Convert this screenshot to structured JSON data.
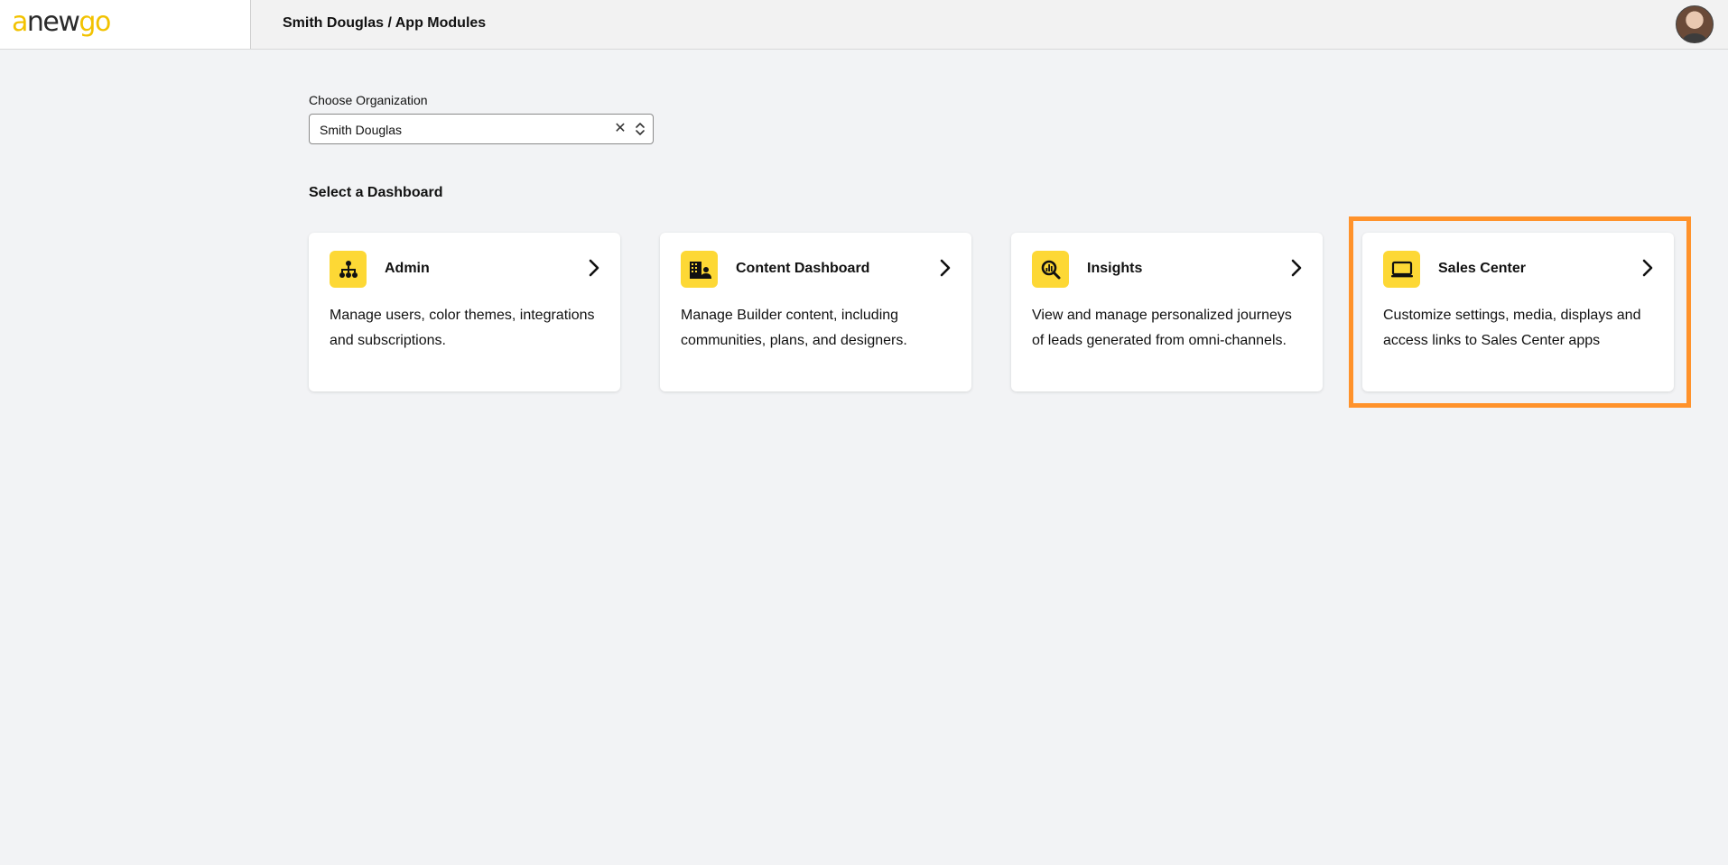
{
  "header": {
    "logo": {
      "prefix": "a",
      "middle": "new",
      "suffix": "go"
    },
    "breadcrumb": "Smith Douglas / App Modules",
    "avatar_icon": "user-avatar"
  },
  "organization": {
    "label": "Choose Organization",
    "selected": "Smith Douglas"
  },
  "dashboards": {
    "section_title": "Select a Dashboard",
    "accent_color": "#fdd835",
    "highlight_color": "#ff922b",
    "cards": [
      {
        "title": "Admin",
        "description": "Manage users, color themes, integrations and subscriptions.",
        "icon": "org-chart-icon"
      },
      {
        "title": "Content Dashboard",
        "description": "Manage Builder content, including communities, plans, and designers.",
        "icon": "building-user-icon"
      },
      {
        "title": "Insights",
        "description": "View and manage personalized journeys of leads generated from omni-channels.",
        "icon": "chart-search-icon"
      },
      {
        "title": "Sales Center",
        "description": "Customize settings, media, displays and access links to Sales Center apps",
        "icon": "monitor-icon",
        "highlighted": true
      }
    ]
  }
}
